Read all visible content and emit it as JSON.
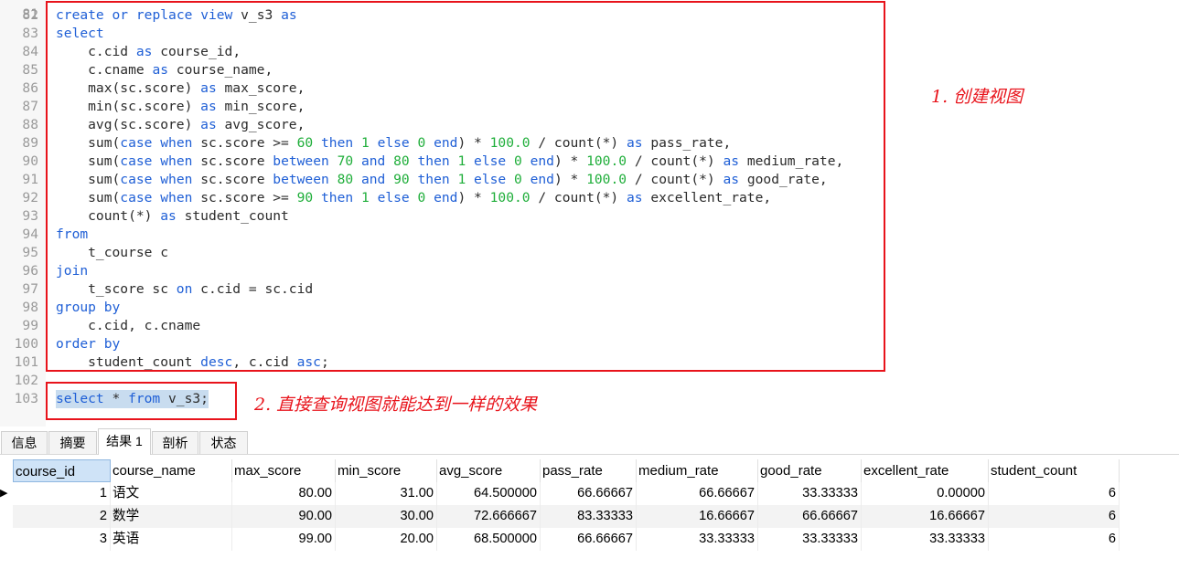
{
  "editor": {
    "partial_line_number": "81",
    "lines": [
      {
        "n": "82",
        "segs": [
          {
            "t": "create",
            "c": "kw"
          },
          {
            "t": " ",
            "c": "txt"
          },
          {
            "t": "or",
            "c": "kw"
          },
          {
            "t": " ",
            "c": "txt"
          },
          {
            "t": "replace",
            "c": "kw"
          },
          {
            "t": " ",
            "c": "txt"
          },
          {
            "t": "view",
            "c": "kw"
          },
          {
            "t": " v_s3 ",
            "c": "txt"
          },
          {
            "t": "as",
            "c": "kw"
          }
        ]
      },
      {
        "n": "83",
        "segs": [
          {
            "t": "select",
            "c": "kw"
          }
        ]
      },
      {
        "n": "84",
        "segs": [
          {
            "t": "    c.cid ",
            "c": "txt"
          },
          {
            "t": "as",
            "c": "kw"
          },
          {
            "t": " course_id,",
            "c": "txt"
          }
        ]
      },
      {
        "n": "85",
        "segs": [
          {
            "t": "    c.cname ",
            "c": "txt"
          },
          {
            "t": "as",
            "c": "kw"
          },
          {
            "t": " course_name,",
            "c": "txt"
          }
        ]
      },
      {
        "n": "86",
        "segs": [
          {
            "t": "    max(sc.score) ",
            "c": "txt"
          },
          {
            "t": "as",
            "c": "kw"
          },
          {
            "t": " max_score,",
            "c": "txt"
          }
        ]
      },
      {
        "n": "87",
        "segs": [
          {
            "t": "    min(sc.score) ",
            "c": "txt"
          },
          {
            "t": "as",
            "c": "kw"
          },
          {
            "t": " min_score,",
            "c": "txt"
          }
        ]
      },
      {
        "n": "88",
        "segs": [
          {
            "t": "    avg(sc.score) ",
            "c": "txt"
          },
          {
            "t": "as",
            "c": "kw"
          },
          {
            "t": " avg_score,",
            "c": "txt"
          }
        ]
      },
      {
        "n": "89",
        "segs": [
          {
            "t": "    sum(",
            "c": "txt"
          },
          {
            "t": "case",
            "c": "kw"
          },
          {
            "t": " ",
            "c": "txt"
          },
          {
            "t": "when",
            "c": "kw"
          },
          {
            "t": " sc.score >= ",
            "c": "txt"
          },
          {
            "t": "60",
            "c": "num"
          },
          {
            "t": " ",
            "c": "txt"
          },
          {
            "t": "then",
            "c": "kw"
          },
          {
            "t": " ",
            "c": "txt"
          },
          {
            "t": "1",
            "c": "num"
          },
          {
            "t": " ",
            "c": "txt"
          },
          {
            "t": "else",
            "c": "kw"
          },
          {
            "t": " ",
            "c": "txt"
          },
          {
            "t": "0",
            "c": "num"
          },
          {
            "t": " ",
            "c": "txt"
          },
          {
            "t": "end",
            "c": "kw"
          },
          {
            "t": ") * ",
            "c": "txt"
          },
          {
            "t": "100.0",
            "c": "num"
          },
          {
            "t": " / count(*) ",
            "c": "txt"
          },
          {
            "t": "as",
            "c": "kw"
          },
          {
            "t": " pass_rate,",
            "c": "txt"
          }
        ]
      },
      {
        "n": "90",
        "segs": [
          {
            "t": "    sum(",
            "c": "txt"
          },
          {
            "t": "case",
            "c": "kw"
          },
          {
            "t": " ",
            "c": "txt"
          },
          {
            "t": "when",
            "c": "kw"
          },
          {
            "t": " sc.score ",
            "c": "txt"
          },
          {
            "t": "between",
            "c": "kw"
          },
          {
            "t": " ",
            "c": "txt"
          },
          {
            "t": "70",
            "c": "num"
          },
          {
            "t": " ",
            "c": "txt"
          },
          {
            "t": "and",
            "c": "kw"
          },
          {
            "t": " ",
            "c": "txt"
          },
          {
            "t": "80",
            "c": "num"
          },
          {
            "t": " ",
            "c": "txt"
          },
          {
            "t": "then",
            "c": "kw"
          },
          {
            "t": " ",
            "c": "txt"
          },
          {
            "t": "1",
            "c": "num"
          },
          {
            "t": " ",
            "c": "txt"
          },
          {
            "t": "else",
            "c": "kw"
          },
          {
            "t": " ",
            "c": "txt"
          },
          {
            "t": "0",
            "c": "num"
          },
          {
            "t": " ",
            "c": "txt"
          },
          {
            "t": "end",
            "c": "kw"
          },
          {
            "t": ") * ",
            "c": "txt"
          },
          {
            "t": "100.0",
            "c": "num"
          },
          {
            "t": " / count(*) ",
            "c": "txt"
          },
          {
            "t": "as",
            "c": "kw"
          },
          {
            "t": " medium_rate,",
            "c": "txt"
          }
        ]
      },
      {
        "n": "91",
        "segs": [
          {
            "t": "    sum(",
            "c": "txt"
          },
          {
            "t": "case",
            "c": "kw"
          },
          {
            "t": " ",
            "c": "txt"
          },
          {
            "t": "when",
            "c": "kw"
          },
          {
            "t": " sc.score ",
            "c": "txt"
          },
          {
            "t": "between",
            "c": "kw"
          },
          {
            "t": " ",
            "c": "txt"
          },
          {
            "t": "80",
            "c": "num"
          },
          {
            "t": " ",
            "c": "txt"
          },
          {
            "t": "and",
            "c": "kw"
          },
          {
            "t": " ",
            "c": "txt"
          },
          {
            "t": "90",
            "c": "num"
          },
          {
            "t": " ",
            "c": "txt"
          },
          {
            "t": "then",
            "c": "kw"
          },
          {
            "t": " ",
            "c": "txt"
          },
          {
            "t": "1",
            "c": "num"
          },
          {
            "t": " ",
            "c": "txt"
          },
          {
            "t": "else",
            "c": "kw"
          },
          {
            "t": " ",
            "c": "txt"
          },
          {
            "t": "0",
            "c": "num"
          },
          {
            "t": " ",
            "c": "txt"
          },
          {
            "t": "end",
            "c": "kw"
          },
          {
            "t": ") * ",
            "c": "txt"
          },
          {
            "t": "100.0",
            "c": "num"
          },
          {
            "t": " / count(*) ",
            "c": "txt"
          },
          {
            "t": "as",
            "c": "kw"
          },
          {
            "t": " good_rate,",
            "c": "txt"
          }
        ]
      },
      {
        "n": "92",
        "segs": [
          {
            "t": "    sum(",
            "c": "txt"
          },
          {
            "t": "case",
            "c": "kw"
          },
          {
            "t": " ",
            "c": "txt"
          },
          {
            "t": "when",
            "c": "kw"
          },
          {
            "t": " sc.score >= ",
            "c": "txt"
          },
          {
            "t": "90",
            "c": "num"
          },
          {
            "t": " ",
            "c": "txt"
          },
          {
            "t": "then",
            "c": "kw"
          },
          {
            "t": " ",
            "c": "txt"
          },
          {
            "t": "1",
            "c": "num"
          },
          {
            "t": " ",
            "c": "txt"
          },
          {
            "t": "else",
            "c": "kw"
          },
          {
            "t": " ",
            "c": "txt"
          },
          {
            "t": "0",
            "c": "num"
          },
          {
            "t": " ",
            "c": "txt"
          },
          {
            "t": "end",
            "c": "kw"
          },
          {
            "t": ") * ",
            "c": "txt"
          },
          {
            "t": "100.0",
            "c": "num"
          },
          {
            "t": " / count(*) ",
            "c": "txt"
          },
          {
            "t": "as",
            "c": "kw"
          },
          {
            "t": " excellent_rate,",
            "c": "txt"
          }
        ]
      },
      {
        "n": "93",
        "segs": [
          {
            "t": "    count(*) ",
            "c": "txt"
          },
          {
            "t": "as",
            "c": "kw"
          },
          {
            "t": " student_count",
            "c": "txt"
          }
        ]
      },
      {
        "n": "94",
        "segs": [
          {
            "t": "from",
            "c": "kw"
          }
        ]
      },
      {
        "n": "95",
        "segs": [
          {
            "t": "    t_course c",
            "c": "txt"
          }
        ]
      },
      {
        "n": "96",
        "segs": [
          {
            "t": "join",
            "c": "kw"
          }
        ]
      },
      {
        "n": "97",
        "segs": [
          {
            "t": "    t_score sc ",
            "c": "txt"
          },
          {
            "t": "on",
            "c": "kw"
          },
          {
            "t": " c.cid = sc.cid",
            "c": "txt"
          }
        ]
      },
      {
        "n": "98",
        "segs": [
          {
            "t": "group by",
            "c": "kw"
          }
        ]
      },
      {
        "n": "99",
        "segs": [
          {
            "t": "    c.cid, c.cname",
            "c": "txt"
          }
        ]
      },
      {
        "n": "100",
        "segs": [
          {
            "t": "order by",
            "c": "kw"
          }
        ]
      },
      {
        "n": "101",
        "segs": [
          {
            "t": "    student_count ",
            "c": "txt"
          },
          {
            "t": "desc",
            "c": "kw"
          },
          {
            "t": ", c.cid ",
            "c": "txt"
          },
          {
            "t": "asc",
            "c": "kw"
          },
          {
            "t": ";",
            "c": "txt"
          }
        ]
      },
      {
        "n": "102",
        "segs": []
      },
      {
        "n": "103",
        "segs": [
          {
            "t": "select",
            "c": "kw"
          },
          {
            "t": " * ",
            "c": "txt"
          },
          {
            "t": "from",
            "c": "kw"
          },
          {
            "t": " v_s3;",
            "c": "txt"
          }
        ],
        "selected": true
      }
    ]
  },
  "annotations": {
    "note1": "1. 创建视图",
    "note2": "2. 直接查询视图就能达到一样的效果"
  },
  "tabs": [
    {
      "label": "信息",
      "active": false
    },
    {
      "label": "摘要",
      "active": false
    },
    {
      "label": "结果 1",
      "active": true
    },
    {
      "label": "剖析",
      "active": false
    },
    {
      "label": "状态",
      "active": false
    }
  ],
  "grid": {
    "columns": [
      "course_id",
      "course_name",
      "max_score",
      "min_score",
      "avg_score",
      "pass_rate",
      "medium_rate",
      "good_rate",
      "excellent_rate",
      "student_count"
    ],
    "rows": [
      [
        "1",
        "语文",
        "80.00",
        "31.00",
        "64.500000",
        "66.66667",
        "66.66667",
        "33.33333",
        "0.00000",
        "6"
      ],
      [
        "2",
        "数学",
        "90.00",
        "30.00",
        "72.666667",
        "83.33333",
        "16.66667",
        "66.66667",
        "16.66667",
        "6"
      ],
      [
        "3",
        "英语",
        "99.00",
        "20.00",
        "68.500000",
        "66.66667",
        "33.33333",
        "33.33333",
        "33.33333",
        "6"
      ]
    ],
    "current_row_indicator": "▶"
  },
  "colors": {
    "keyword": "#1f5fd6",
    "number": "#1fae3a",
    "annotation": "#e8131b",
    "selection": "#c8dcef"
  }
}
